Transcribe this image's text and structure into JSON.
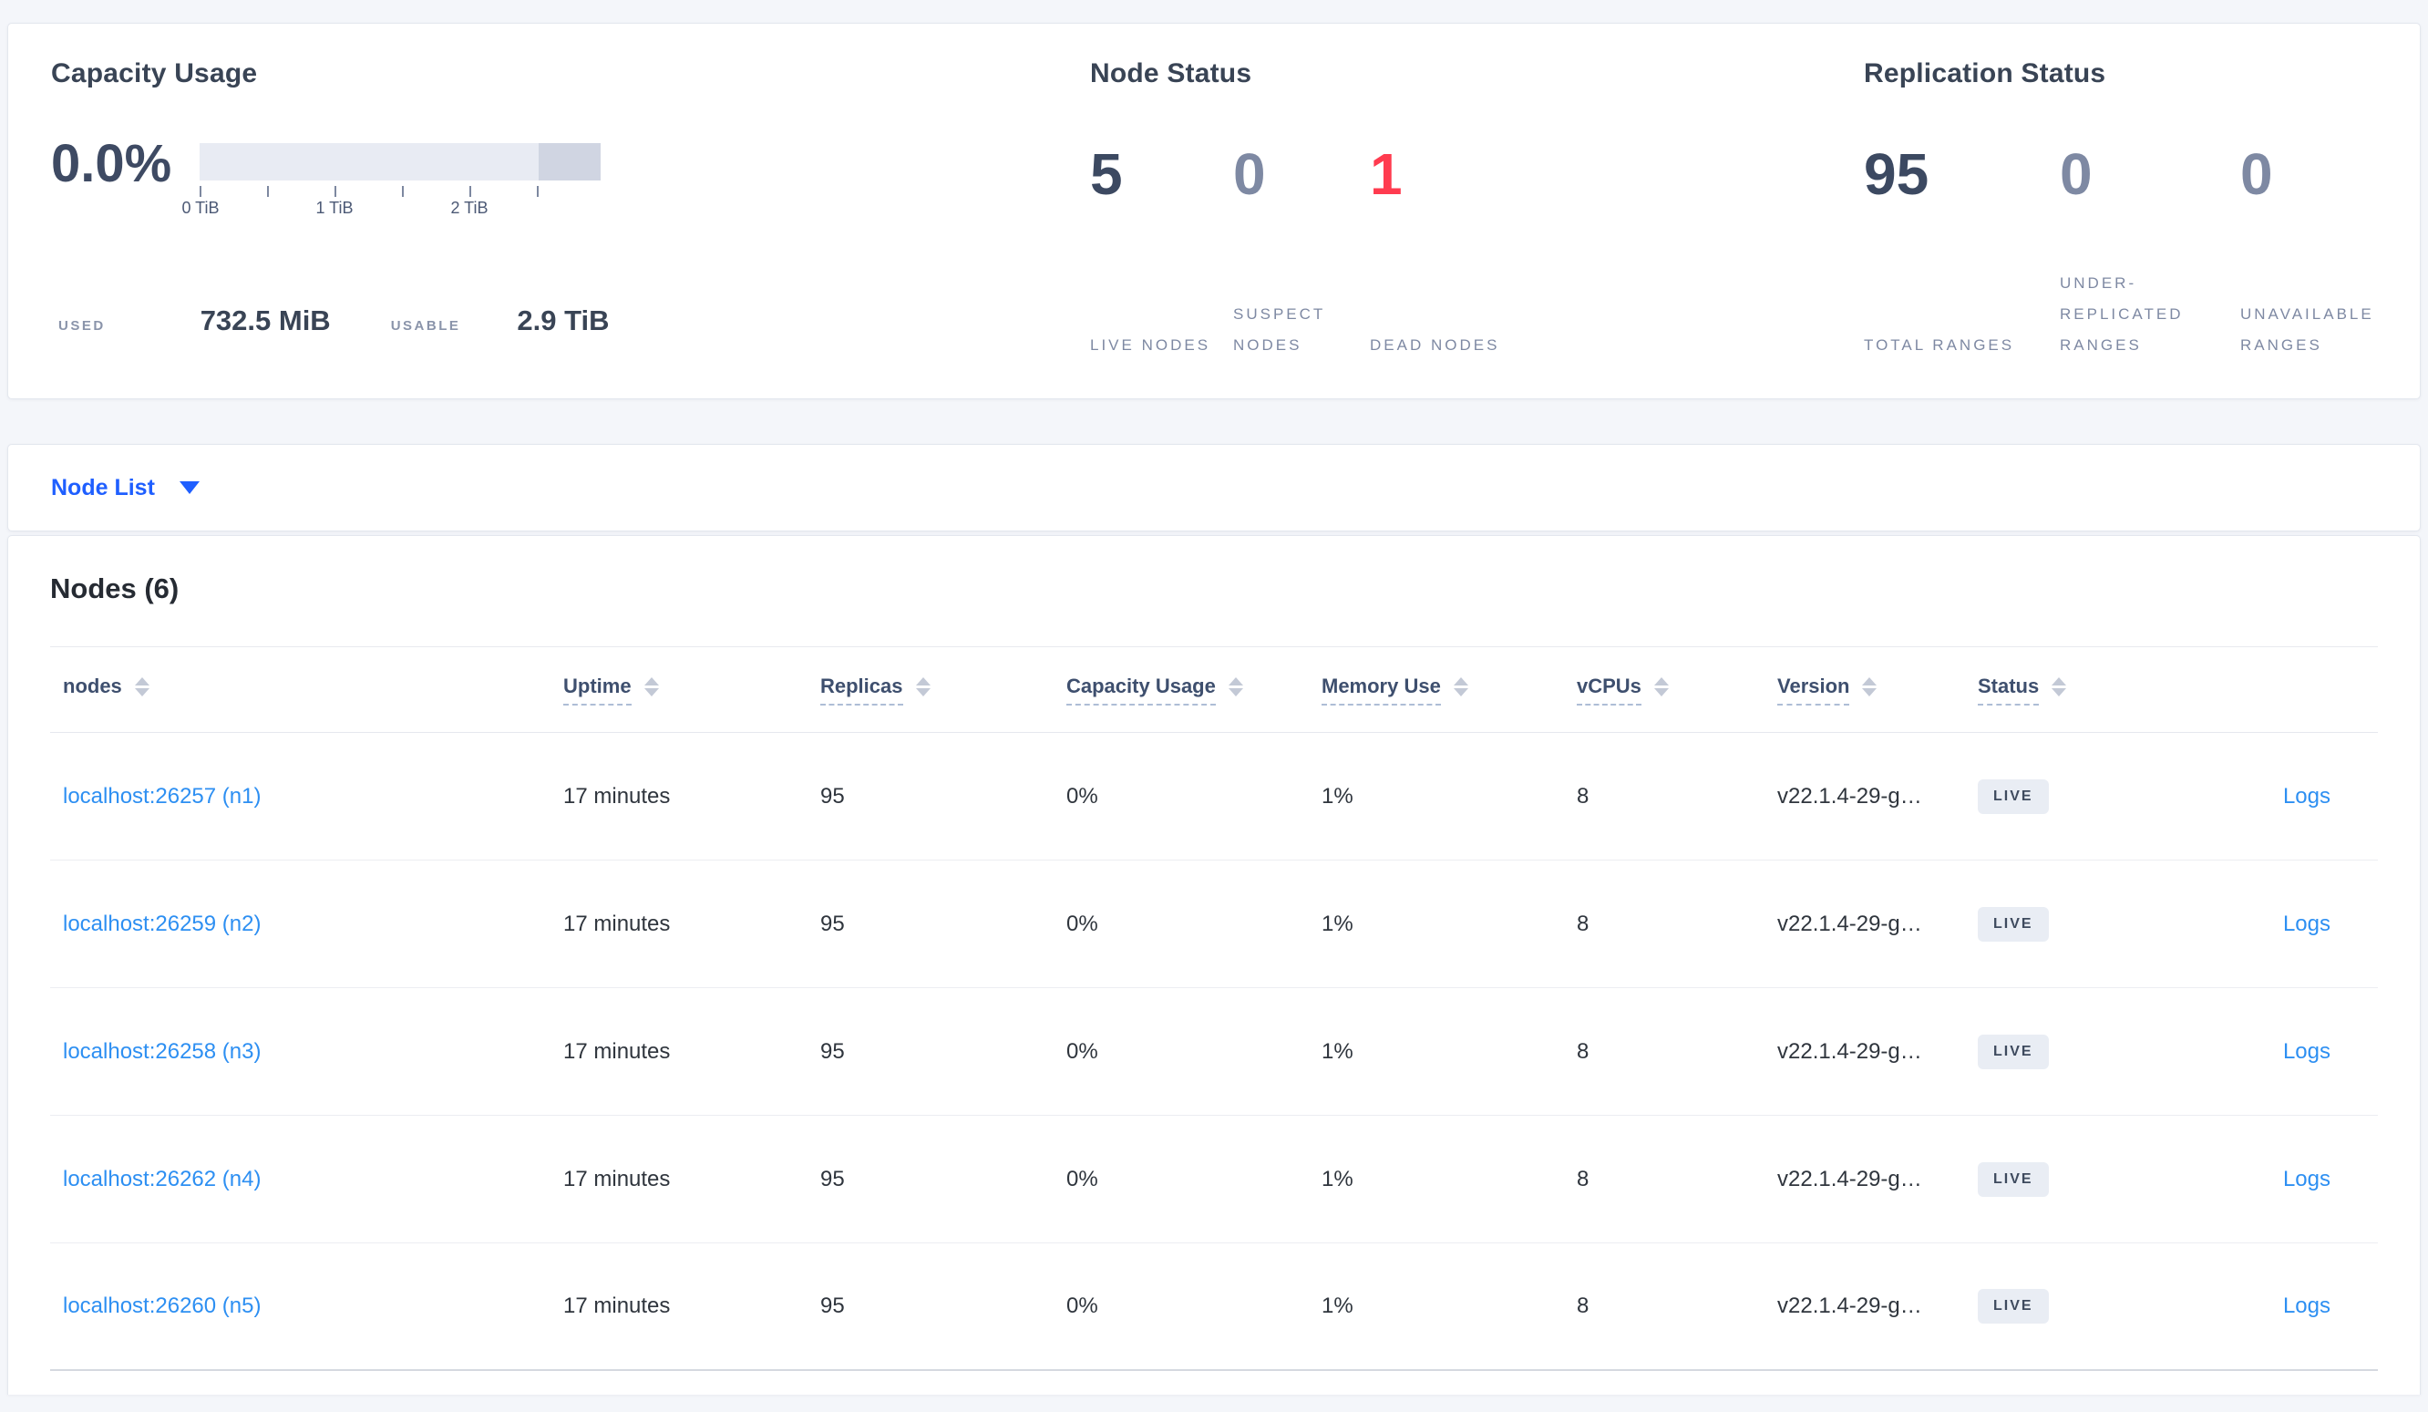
{
  "summary": {
    "capacity": {
      "title": "Capacity Usage",
      "percent": "0.0%",
      "tick_labels": [
        "0 TiB",
        "1 TiB",
        "2 TiB"
      ],
      "used_label": "USED",
      "used_value": "732.5 MiB",
      "usable_label": "USABLE",
      "usable_value": "2.9 TiB"
    },
    "node_status": {
      "title": "Node Status",
      "stats": [
        {
          "value": "5",
          "label": "LIVE NODES",
          "tone": "dark"
        },
        {
          "value": "0",
          "label": "SUSPECT NODES",
          "tone": "muted"
        },
        {
          "value": "1",
          "label": "DEAD NODES",
          "tone": "red"
        }
      ]
    },
    "replication_status": {
      "title": "Replication Status",
      "stats": [
        {
          "value": "95",
          "label": "TOTAL RANGES",
          "tone": "dark"
        },
        {
          "value": "0",
          "label": "UNDER-REPLICATED RANGES",
          "tone": "muted"
        },
        {
          "value": "0",
          "label": "UNAVAILABLE RANGES",
          "tone": "muted"
        }
      ]
    }
  },
  "node_list": {
    "label": "Node List"
  },
  "nodes_section": {
    "title": "Nodes (6)",
    "columns": [
      "nodes",
      "Uptime",
      "Replicas",
      "Capacity Usage",
      "Memory Use",
      "vCPUs",
      "Version",
      "Status"
    ],
    "rows": [
      {
        "node": "localhost:26257 (n1)",
        "uptime": "17 minutes",
        "replicas": "95",
        "capacity_usage": "0%",
        "memory_use": "1%",
        "vcpus": "8",
        "version": "v22.1.4-29-g…",
        "status": "LIVE",
        "logs": "Logs"
      },
      {
        "node": "localhost:26259 (n2)",
        "uptime": "17 minutes",
        "replicas": "95",
        "capacity_usage": "0%",
        "memory_use": "1%",
        "vcpus": "8",
        "version": "v22.1.4-29-g…",
        "status": "LIVE",
        "logs": "Logs"
      },
      {
        "node": "localhost:26258 (n3)",
        "uptime": "17 minutes",
        "replicas": "95",
        "capacity_usage": "0%",
        "memory_use": "1%",
        "vcpus": "8",
        "version": "v22.1.4-29-g…",
        "status": "LIVE",
        "logs": "Logs"
      },
      {
        "node": "localhost:26262 (n4)",
        "uptime": "17 minutes",
        "replicas": "95",
        "capacity_usage": "0%",
        "memory_use": "1%",
        "vcpus": "8",
        "version": "v22.1.4-29-g…",
        "status": "LIVE",
        "logs": "Logs"
      },
      {
        "node": "localhost:26260 (n5)",
        "uptime": "17 minutes",
        "replicas": "95",
        "capacity_usage": "0%",
        "memory_use": "1%",
        "vcpus": "8",
        "version": "v22.1.4-29-g…",
        "status": "LIVE",
        "logs": "Logs"
      }
    ]
  },
  "colors": {
    "accent_blue": "#1f5fff",
    "link_blue": "#2d8ff2",
    "dead_red": "#ff3b4f",
    "bar_light": "#e8ebf3",
    "bar_dark": "#d0d5e2"
  }
}
